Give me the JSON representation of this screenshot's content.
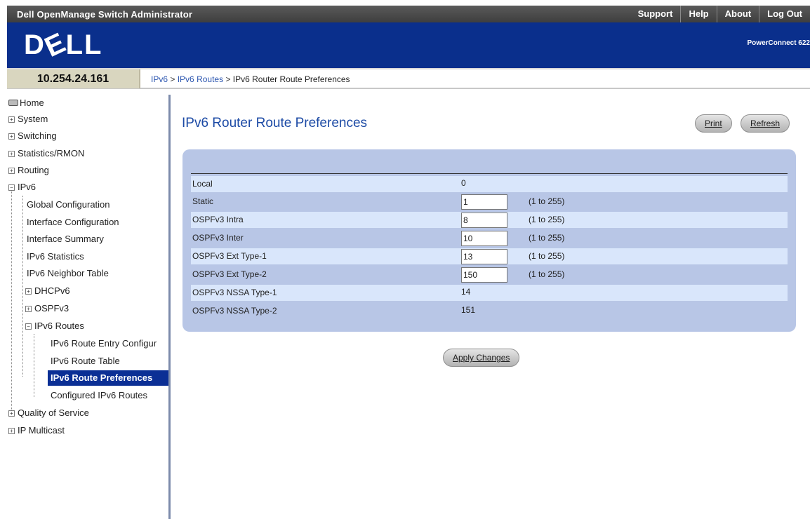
{
  "header": {
    "app_title": "Dell OpenManage Switch Administrator",
    "links": [
      "Support",
      "Help",
      "About",
      "Log Out"
    ],
    "brand": "DELL",
    "product": "PowerConnect 622"
  },
  "infobar": {
    "ip": "10.254.24.161",
    "breadcrumb": [
      "IPv6",
      "IPv6 Routes",
      "IPv6 Router Route Preferences"
    ],
    "sep": ">"
  },
  "nav": {
    "items": [
      "Home",
      "System",
      "Switching",
      "Statistics/RMON",
      "Routing",
      "IPv6",
      "Global Configuration",
      "Interface Configuration",
      "Interface Summary",
      "IPv6 Statistics",
      "IPv6 Neighbor Table",
      "DHCPv6",
      "OSPFv3",
      "IPv6 Routes",
      "IPv6 Route Entry Configur",
      "IPv6 Route Table",
      "IPv6 Route Preferences",
      "Configured IPv6 Routes",
      "Quality of Service",
      "IP Multicast"
    ],
    "expanders": {
      "plus": "+",
      "minus": "−"
    }
  },
  "main": {
    "title": "IPv6 Router Route Preferences",
    "print_label": "Print",
    "refresh_label": "Refresh",
    "apply_label": "Apply Changes",
    "rows": [
      {
        "label": "Local",
        "value": "0",
        "range": ""
      },
      {
        "label": "Static",
        "value": "1",
        "range": "(1 to 255)"
      },
      {
        "label": "OSPFv3 Intra",
        "value": "8",
        "range": "(1 to 255)"
      },
      {
        "label": "OSPFv3 Inter",
        "value": "10",
        "range": "(1 to 255)"
      },
      {
        "label": "OSPFv3 Ext Type-1",
        "value": "13",
        "range": "(1 to 255)"
      },
      {
        "label": "OSPFv3 Ext Type-2",
        "value": "150",
        "range": "(1 to 255)"
      },
      {
        "label": "OSPFv3 NSSA Type-1",
        "value": "14",
        "range": ""
      },
      {
        "label": "OSPFv3 NSSA Type-2",
        "value": "151",
        "range": ""
      }
    ]
  },
  "colors": {
    "brand_blue": "#0a2f8c",
    "title_blue": "#1c4aa5",
    "panel_blue": "#b8c6e6",
    "row_highlight": "#d9e6fb",
    "nav_selected": "#0b2f95"
  }
}
